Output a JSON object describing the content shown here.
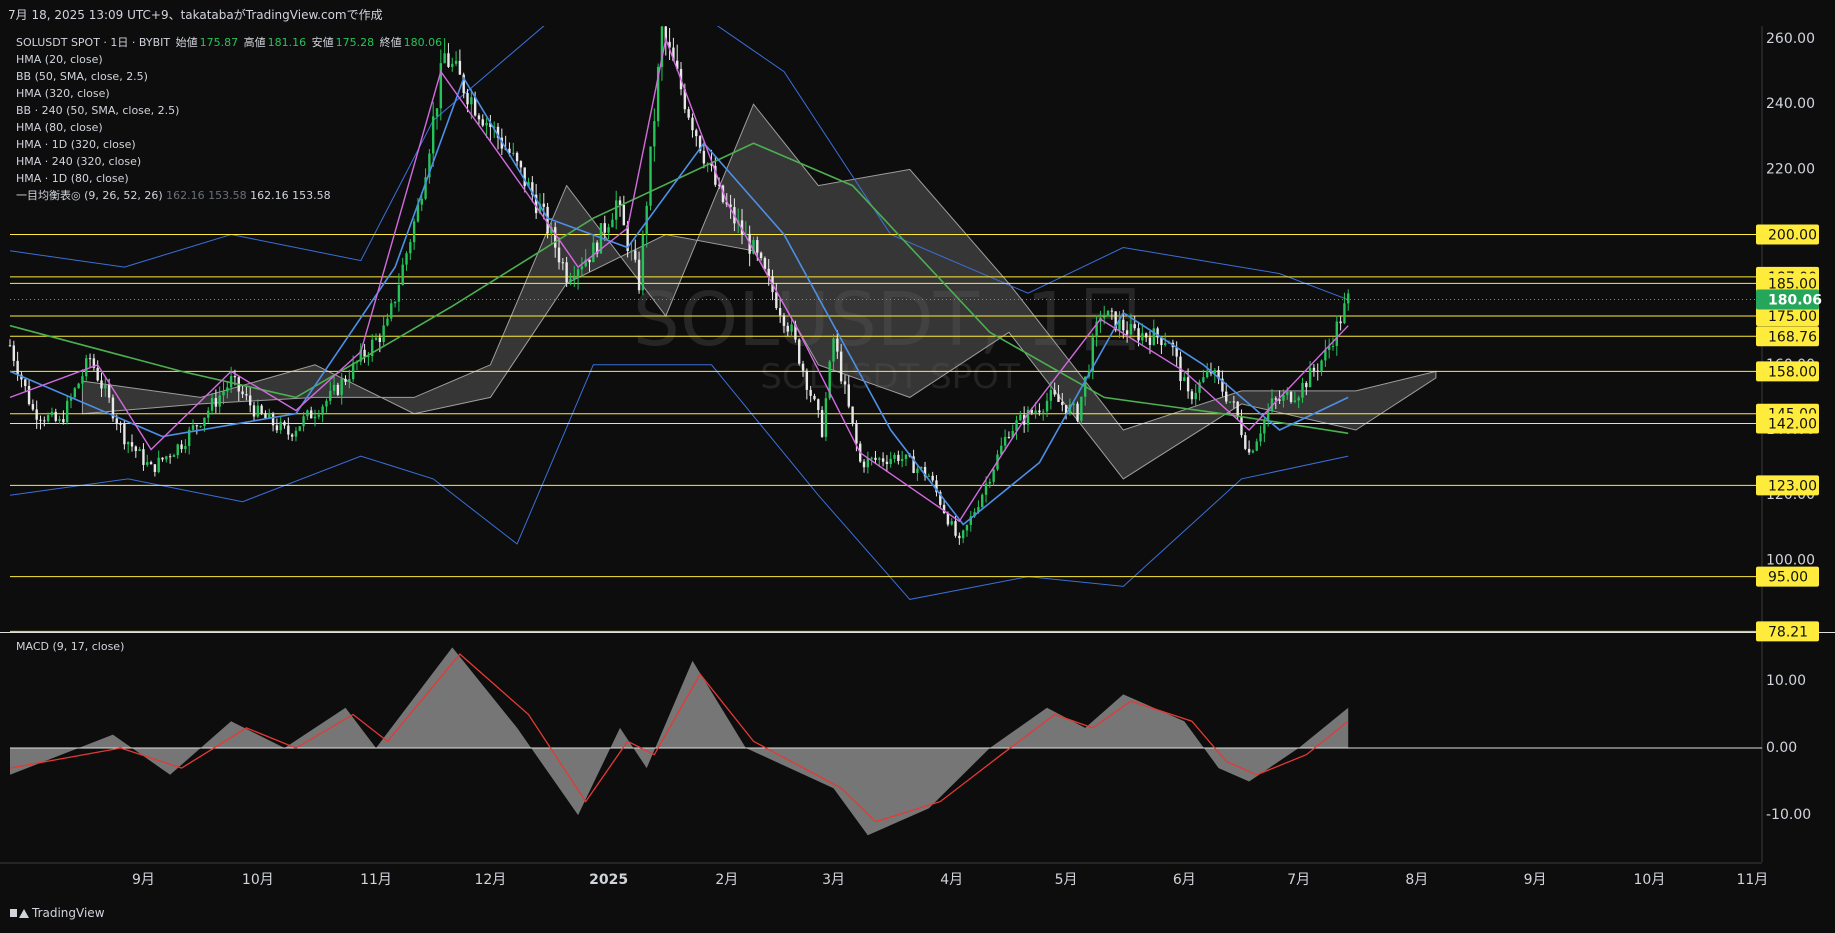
{
  "header": {
    "text": "7月 18, 2025 13:09 UTC+9、takatabaがTradingView.comで作成"
  },
  "legend": {
    "symbol": "SOLUSDT SPOT · 1日 · BYBIT",
    "open_label": "始値",
    "open": "175.87",
    "high_label": "高値",
    "high": "181.16",
    "low_label": "安値",
    "low": "175.28",
    "close_label": "終値",
    "close": "180.06",
    "indicators": [
      "HMA (20, close)",
      "BB (50, SMA, close, 2.5)",
      "HMA (320, close)",
      "BB · 240 (50, SMA, close, 2.5)",
      "HMA (80, close)",
      "HMA · 1D (320, close)",
      "HMA · 240 (320, close)",
      "HMA · 1D (80, close)"
    ],
    "ichimoku": {
      "name": "一目均衡表◎ (9, 26, 52, 26)",
      "v1": "162.16",
      "v2": "153.58",
      "v3": "162.16",
      "v4": "153.58"
    }
  },
  "watermark": {
    "main": "SOLUSDT, 1日",
    "sub": "SOLUSDT SPOT"
  },
  "macd_label": "MACD (9, 17, close)",
  "footer": {
    "brand": "TradingView"
  },
  "colors": {
    "up": "#26c35a",
    "down": "#e8e8e8",
    "hma20": "#d36be0",
    "bb": "#3b6fd8",
    "hma80": "#4d8fe6",
    "hma320": "#4caf50",
    "level": "#ffeb3b",
    "cloud": "#5a5a5a",
    "macd_hist": "#8a8a8a",
    "signal": "#e53935",
    "last_price": "#26a65b"
  },
  "chart_data": [
    {
      "type": "candlestick",
      "title": "SOLUSDT SPOT · 1日 · BYBIT",
      "x_labels": [
        "9月",
        "10月",
        "11月",
        "12月",
        "2025",
        "2月",
        "3月",
        "4月",
        "5月",
        "6月",
        "7月",
        "8月",
        "9月",
        "10月",
        "11月"
      ],
      "y_ticks": [
        100,
        120,
        140,
        160,
        180,
        200,
        220,
        240,
        260
      ],
      "ylim": [
        78,
        264
      ],
      "last_price": 180.06,
      "levels": [
        200.0,
        187.0,
        185.0,
        175.0,
        168.76,
        158.0,
        145.0,
        142.0,
        123.0,
        95.0,
        78.21
      ],
      "level_labels": [
        "200.00",
        "187.00",
        "185.00",
        "175.00",
        "168.76",
        "158.00",
        "145.00",
        "142.00",
        "123.00",
        "95.00",
        "78.21"
      ],
      "last_price_label": "180.06",
      "price_path": [
        [
          "2024-08-01",
          166
        ],
        [
          "2024-08-07",
          146
        ],
        [
          "2024-08-14",
          142
        ],
        [
          "2024-08-22",
          162
        ],
        [
          "2024-08-31",
          138
        ],
        [
          "2024-09-07",
          128
        ],
        [
          "2024-09-15",
          136
        ],
        [
          "2024-09-28",
          155
        ],
        [
          "2024-10-05",
          145
        ],
        [
          "2024-10-13",
          139
        ],
        [
          "2024-10-24",
          150
        ],
        [
          "2024-11-01",
          162
        ],
        [
          "2024-11-08",
          172
        ],
        [
          "2024-11-16",
          208
        ],
        [
          "2024-11-23",
          255
        ],
        [
          "2024-12-01",
          240
        ],
        [
          "2024-12-10",
          225
        ],
        [
          "2024-12-18",
          208
        ],
        [
          "2024-12-25",
          188
        ],
        [
          "2025-01-01",
          195
        ],
        [
          "2025-01-07",
          210
        ],
        [
          "2025-01-13",
          185
        ],
        [
          "2025-01-19",
          262
        ],
        [
          "2025-01-26",
          238
        ],
        [
          "2025-02-03",
          212
        ],
        [
          "2025-02-12",
          195
        ],
        [
          "2025-02-22",
          170
        ],
        [
          "2025-03-02",
          140
        ],
        [
          "2025-03-05",
          168
        ],
        [
          "2025-03-12",
          130
        ],
        [
          "2025-03-22",
          132
        ],
        [
          "2025-03-30",
          126
        ],
        [
          "2025-04-07",
          105
        ],
        [
          "2025-04-12",
          118
        ],
        [
          "2025-04-20",
          140
        ],
        [
          "2025-05-01",
          150
        ],
        [
          "2025-05-08",
          145
        ],
        [
          "2025-05-14",
          176
        ],
        [
          "2025-05-22",
          170
        ],
        [
          "2025-06-01",
          168
        ],
        [
          "2025-06-06",
          150
        ],
        [
          "2025-06-12",
          158
        ],
        [
          "2025-06-18",
          147
        ],
        [
          "2025-06-22",
          133
        ],
        [
          "2025-06-28",
          148
        ],
        [
          "2025-07-05",
          152
        ],
        [
          "2025-07-12",
          163
        ],
        [
          "2025-07-18",
          180
        ]
      ],
      "hma20": [
        [
          "2024-08-01",
          150
        ],
        [
          "2024-08-24",
          160
        ],
        [
          "2024-09-07",
          134
        ],
        [
          "2024-09-28",
          158
        ],
        [
          "2024-10-15",
          146
        ],
        [
          "2024-11-01",
          164
        ],
        [
          "2024-11-22",
          250
        ],
        [
          "2024-12-15",
          212
        ],
        [
          "2024-12-28",
          190
        ],
        [
          "2025-01-10",
          202
        ],
        [
          "2025-01-20",
          260
        ],
        [
          "2025-02-05",
          210
        ],
        [
          "2025-02-24",
          170
        ],
        [
          "2025-03-12",
          133
        ],
        [
          "2025-04-07",
          112
        ],
        [
          "2025-04-25",
          145
        ],
        [
          "2025-05-14",
          174
        ],
        [
          "2025-06-05",
          158
        ],
        [
          "2025-06-22",
          140
        ],
        [
          "2025-07-18",
          172
        ]
      ],
      "hma80": [
        [
          "2024-08-01",
          158
        ],
        [
          "2024-09-10",
          138
        ],
        [
          "2024-10-15",
          145
        ],
        [
          "2024-11-10",
          190
        ],
        [
          "2024-11-28",
          248
        ],
        [
          "2024-12-20",
          205
        ],
        [
          "2025-01-10",
          196
        ],
        [
          "2025-01-30",
          228
        ],
        [
          "2025-02-20",
          200
        ],
        [
          "2025-03-20",
          140
        ],
        [
          "2025-04-08",
          111
        ],
        [
          "2025-04-28",
          130
        ],
        [
          "2025-05-20",
          176
        ],
        [
          "2025-06-10",
          160
        ],
        [
          "2025-06-30",
          140
        ],
        [
          "2025-07-18",
          150
        ]
      ],
      "hma320": [
        [
          "2024-08-01",
          172
        ],
        [
          "2024-09-15",
          158
        ],
        [
          "2024-10-15",
          150
        ],
        [
          "2024-11-25",
          178
        ],
        [
          "2025-01-01",
          205
        ],
        [
          "2025-02-12",
          228
        ],
        [
          "2025-03-10",
          215
        ],
        [
          "2025-04-15",
          170
        ],
        [
          "2025-05-15",
          150
        ],
        [
          "2025-06-15",
          145
        ],
        [
          "2025-07-18",
          139
        ]
      ],
      "bb_upper": [
        [
          "2024-08-01",
          195
        ],
        [
          "2024-08-31",
          190
        ],
        [
          "2024-09-28",
          200
        ],
        [
          "2024-11-01",
          192
        ],
        [
          "2024-11-20",
          235
        ],
        [
          "2024-12-20",
          265
        ],
        [
          "2025-01-20",
          275
        ],
        [
          "2025-02-20",
          250
        ],
        [
          "2025-03-20",
          200
        ],
        [
          "2025-04-25",
          182
        ],
        [
          "2025-05-20",
          196
        ],
        [
          "2025-06-30",
          188
        ],
        [
          "2025-07-18",
          180
        ]
      ],
      "bb_lower": [
        [
          "2024-08-01",
          120
        ],
        [
          "2024-09-01",
          125
        ],
        [
          "2024-10-01",
          118
        ],
        [
          "2024-11-01",
          132
        ],
        [
          "2024-11-20",
          125
        ],
        [
          "2024-12-12",
          105
        ],
        [
          "2025-01-01",
          160
        ],
        [
          "2025-02-01",
          160
        ],
        [
          "2025-03-01",
          120
        ],
        [
          "2025-03-25",
          88
        ],
        [
          "2025-04-25",
          95
        ],
        [
          "2025-05-20",
          92
        ],
        [
          "2025-06-20",
          125
        ],
        [
          "2025-07-18",
          132
        ]
      ],
      "cloud_a": [
        [
          "2024-08-20",
          145
        ],
        [
          "2024-09-20",
          148
        ],
        [
          "2024-10-20",
          150
        ],
        [
          "2024-11-15",
          150
        ],
        [
          "2024-12-05",
          160
        ],
        [
          "2024-12-25",
          215
        ],
        [
          "2025-01-20",
          175
        ],
        [
          "2025-02-12",
          240
        ],
        [
          "2025-03-01",
          215
        ],
        [
          "2025-03-25",
          220
        ],
        [
          "2025-04-20",
          185
        ],
        [
          "2025-05-20",
          140
        ],
        [
          "2025-06-20",
          152
        ],
        [
          "2025-07-20",
          152
        ],
        [
          "2025-08-10",
          158
        ]
      ],
      "cloud_b": [
        [
          "2024-08-20",
          155
        ],
        [
          "2024-09-20",
          150
        ],
        [
          "2024-10-20",
          160
        ],
        [
          "2024-11-15",
          145
        ],
        [
          "2024-12-05",
          150
        ],
        [
          "2024-12-25",
          185
        ],
        [
          "2025-01-20",
          200
        ],
        [
          "2025-02-12",
          195
        ],
        [
          "2025-03-01",
          160
        ],
        [
          "2025-03-25",
          150
        ],
        [
          "2025-04-20",
          170
        ],
        [
          "2025-05-20",
          125
        ],
        [
          "2025-06-20",
          148
        ],
        [
          "2025-07-20",
          140
        ],
        [
          "2025-08-10",
          156
        ]
      ]
    },
    {
      "type": "macd",
      "title": "MACD (9, 17, close)",
      "y_ticks": [
        -10.0,
        0.0,
        10.0
      ],
      "y_tick_labels": [
        "-10.00",
        "0.00",
        "10.00"
      ],
      "ylim": [
        -17,
        17
      ],
      "macd": [
        [
          "2024-08-01",
          -4
        ],
        [
          "2024-08-28",
          2
        ],
        [
          "2024-09-12",
          -4
        ],
        [
          "2024-09-28",
          4
        ],
        [
          "2024-10-12",
          0
        ],
        [
          "2024-10-28",
          6
        ],
        [
          "2024-11-05",
          0
        ],
        [
          "2024-11-25",
          15
        ],
        [
          "2024-12-12",
          3
        ],
        [
          "2024-12-28",
          -10
        ],
        [
          "2025-01-08",
          3
        ],
        [
          "2025-01-15",
          -3
        ],
        [
          "2025-01-27",
          13
        ],
        [
          "2025-02-10",
          0
        ],
        [
          "2025-03-05",
          -6
        ],
        [
          "2025-03-14",
          -13
        ],
        [
          "2025-03-30",
          -9
        ],
        [
          "2025-04-15",
          0
        ],
        [
          "2025-04-30",
          6
        ],
        [
          "2025-05-10",
          3
        ],
        [
          "2025-05-20",
          8
        ],
        [
          "2025-06-05",
          4
        ],
        [
          "2025-06-14",
          -3
        ],
        [
          "2025-06-22",
          -5
        ],
        [
          "2025-07-05",
          0
        ],
        [
          "2025-07-18",
          6
        ]
      ],
      "signal": [
        [
          "2024-08-01",
          -3
        ],
        [
          "2024-08-30",
          0
        ],
        [
          "2024-09-15",
          -3
        ],
        [
          "2024-10-02",
          3
        ],
        [
          "2024-10-15",
          0
        ],
        [
          "2024-10-30",
          5
        ],
        [
          "2024-11-08",
          1
        ],
        [
          "2024-11-27",
          14
        ],
        [
          "2024-12-15",
          5
        ],
        [
          "2024-12-30",
          -8
        ],
        [
          "2025-01-10",
          1
        ],
        [
          "2025-01-17",
          -1
        ],
        [
          "2025-01-29",
          11
        ],
        [
          "2025-02-12",
          1
        ],
        [
          "2025-03-07",
          -6
        ],
        [
          "2025-03-16",
          -11
        ],
        [
          "2025-04-02",
          -8
        ],
        [
          "2025-04-18",
          -1
        ],
        [
          "2025-05-02",
          5
        ],
        [
          "2025-05-12",
          3
        ],
        [
          "2025-05-22",
          7
        ],
        [
          "2025-06-07",
          4
        ],
        [
          "2025-06-16",
          -2
        ],
        [
          "2025-06-24",
          -4
        ],
        [
          "2025-07-07",
          -1
        ],
        [
          "2025-07-18",
          4
        ]
      ]
    }
  ]
}
